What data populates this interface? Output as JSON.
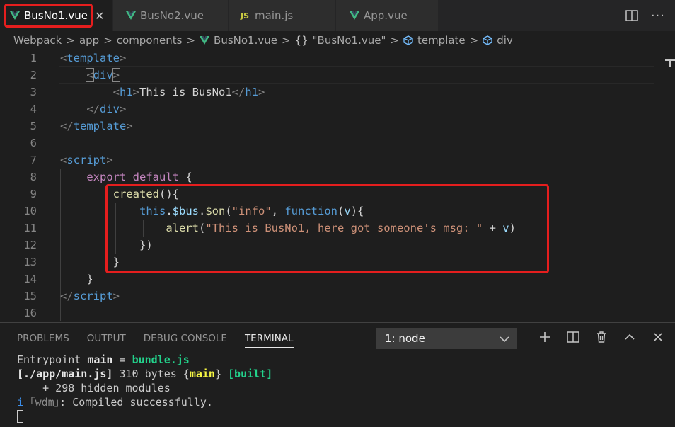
{
  "tabs": [
    {
      "label": "BusNo1.vue",
      "icon": "vue-icon",
      "active": true,
      "close": "✕"
    },
    {
      "label": "BusNo2.vue",
      "icon": "vue-icon",
      "active": false
    },
    {
      "label": "main.js",
      "icon": "js-icon",
      "icon_text": "JS",
      "active": false
    },
    {
      "label": "App.vue",
      "icon": "vue-icon",
      "active": false
    }
  ],
  "tab_actions": {
    "split": "split-editor-icon",
    "more": "···"
  },
  "breadcrumb": {
    "items": [
      "Webpack",
      "app",
      "components",
      "BusNo1.vue",
      "\"BusNo1.vue\"",
      "template",
      "div"
    ],
    "separator": ">",
    "braces": "{}"
  },
  "editor": {
    "line_numbers": [
      "1",
      "2",
      "3",
      "4",
      "5",
      "6",
      "7",
      "8",
      "9",
      "10",
      "11",
      "12",
      "13",
      "14",
      "15",
      "16"
    ]
  },
  "panel": {
    "tabs": [
      "PROBLEMS",
      "OUTPUT",
      "DEBUG CONSOLE",
      "TERMINAL"
    ],
    "active_tab": "TERMINAL",
    "terminal_select": "1: node",
    "terminal": {
      "l1a": "Entrypoint ",
      "l1b": "main",
      "l1c": " = ",
      "l1d": "bundle.js",
      "l2a": "[./app/main.js]",
      "l2b": " 310 bytes {",
      "l2c": "main",
      "l2d": "} ",
      "l2e": "[built]",
      "l3": "    + 298 hidden modules",
      "l4a": "i ",
      "l4b": "｢wdm｣",
      "l4c": ": Compiled successfully."
    }
  },
  "colors": {
    "highlight_box": "#e51e1e",
    "vue_green": "#41b883",
    "keyword": "#c586c0",
    "string": "#ce9178"
  }
}
